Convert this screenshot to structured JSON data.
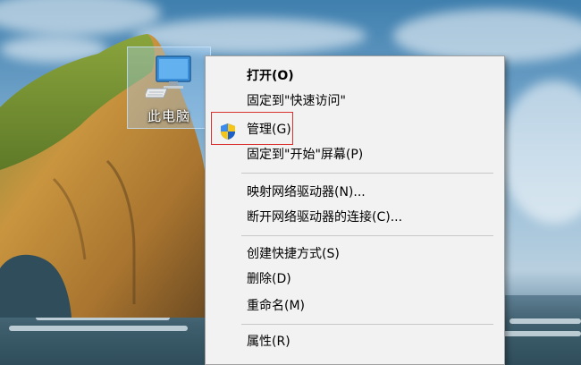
{
  "desktop": {
    "icon_label": "此电脑"
  },
  "context_menu": {
    "items": [
      {
        "label": "打开(O)",
        "bold": true
      },
      {
        "label": "固定到\"快速访问\""
      },
      {
        "label": "管理(G)",
        "icon": "uac-shield-icon"
      },
      {
        "label": "固定到\"开始\"屏幕(P)"
      },
      {
        "label": "映射网络驱动器(N)..."
      },
      {
        "label": "断开网络驱动器的连接(C)..."
      },
      {
        "label": "创建快捷方式(S)"
      },
      {
        "label": "删除(D)"
      },
      {
        "label": "重命名(M)"
      },
      {
        "label": "属性(R)"
      }
    ]
  },
  "colors": {
    "menu_background": "#f2f2f2",
    "highlight_border": "#d8312e"
  }
}
